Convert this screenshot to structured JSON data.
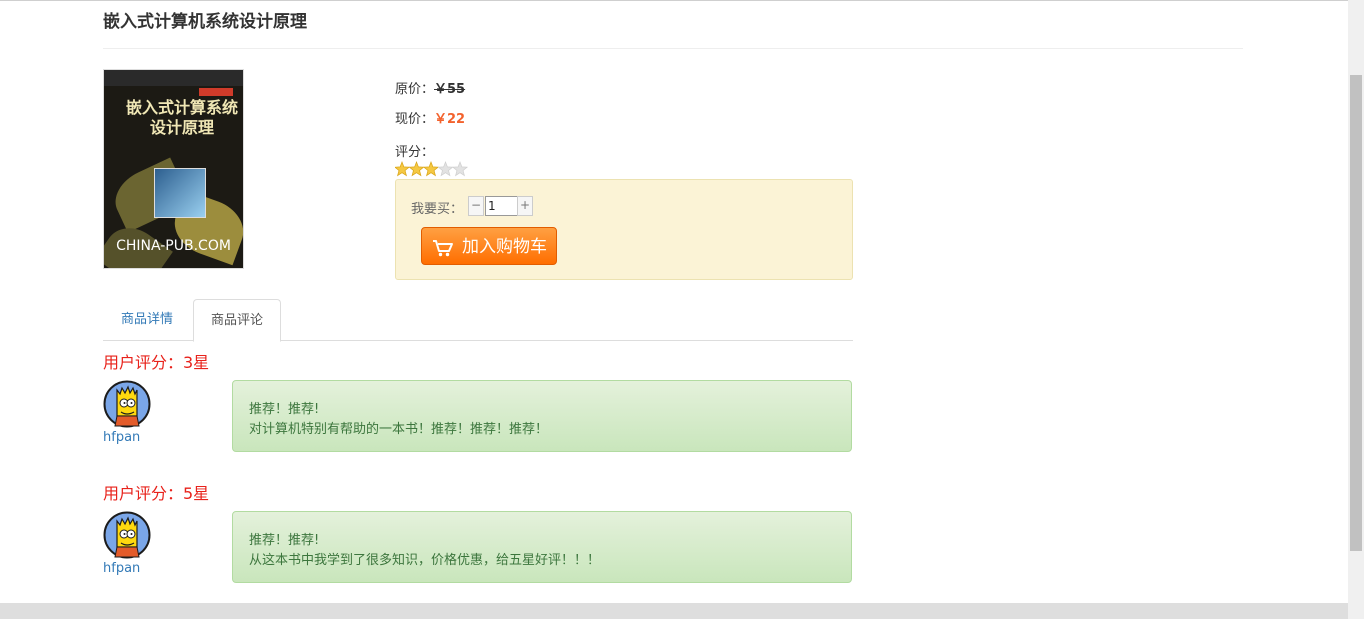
{
  "product": {
    "title": "嵌入式计算机系统设计原理",
    "cover_text": {
      "title_line1": "嵌入式计算系统",
      "title_line2": "设计原理",
      "brand": "CHINA-PUB.COM"
    },
    "original_price_label": "原价：",
    "original_price": "￥55",
    "current_price_label": "现价：",
    "current_price": "￥22",
    "rating_label": "评分：",
    "rating_stars": 3,
    "rating_max": 5
  },
  "buy": {
    "quantity_label": "我要买：",
    "minus": "−",
    "plus": "+",
    "quantity": "1",
    "add_to_cart": "加入购物车"
  },
  "tabs": [
    {
      "label": "商品详情",
      "active": false
    },
    {
      "label": "商品评论",
      "active": true
    }
  ],
  "reviews": [
    {
      "rating_text": "用户评分：3星",
      "user": "hfpan",
      "line1": "推荐！推荐!",
      "line2": "对计算机特别有帮助的一本书！推荐！推荐！推荐！"
    },
    {
      "rating_text": "用户评分：5星",
      "user": "hfpan",
      "line1": "推荐！推荐!",
      "line2": "从这本书中我学到了很多知识，价格优惠，给五星好评！！！"
    }
  ],
  "colors": {
    "accent_price": "#f3622d",
    "rating_red": "#e8221b",
    "link_blue": "#337ab7",
    "comment_green": "#3c763d"
  }
}
